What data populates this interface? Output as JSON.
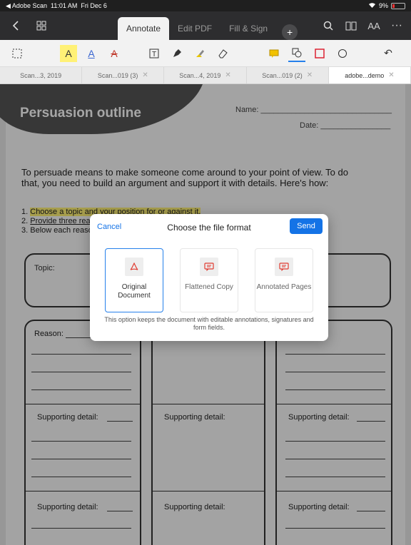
{
  "status": {
    "app": "◀ Adobe Scan",
    "time": "11:01 AM",
    "date": "Fri Dec 6",
    "battery": "9%"
  },
  "topbar": {
    "tabs": [
      {
        "label": "Annotate"
      },
      {
        "label": "Edit PDF"
      },
      {
        "label": "Fill & Sign"
      }
    ],
    "plus": "+",
    "font_size_label": "AA",
    "more": "···"
  },
  "annotation_tools": {
    "text_a": "A",
    "undo": "↶"
  },
  "doc_tabs": [
    {
      "label": "Scan...3, 2019"
    },
    {
      "label": "Scan...019 (3)"
    },
    {
      "label": "Scan...4, 2019"
    },
    {
      "label": "Scan...019 (2)"
    },
    {
      "label": "adobe...demo"
    }
  ],
  "document": {
    "title": "Persuasion outline",
    "name_label": "Name: ______________________________",
    "date_label": "Date: ________________",
    "intro": "To persuade means to make someone come around to your point of view. To do that, you need to build an argument and support it with details. Here's how:",
    "steps": [
      {
        "num": "1.",
        "text": "Choose a topic and your position for or against it."
      },
      {
        "num": "2.",
        "text": "Provide three reasons for your position."
      },
      {
        "num": "3.",
        "text": "Below each reason, ..."
      }
    ],
    "topic_label": "Topic:",
    "reason_label": "Reason:",
    "supporting_label": "Supporting detail:"
  },
  "dialog": {
    "cancel": "Cancel",
    "title": "Choose the file format",
    "send": "Send",
    "options": [
      {
        "label": "Original Document",
        "icon": "pdf-icon"
      },
      {
        "label": "Flattened Copy",
        "icon": "comment-icon"
      },
      {
        "label": "Annotated Pages",
        "icon": "comment-icon"
      }
    ],
    "description": "This option keeps the document with editable annotations, signatures and form fields."
  }
}
